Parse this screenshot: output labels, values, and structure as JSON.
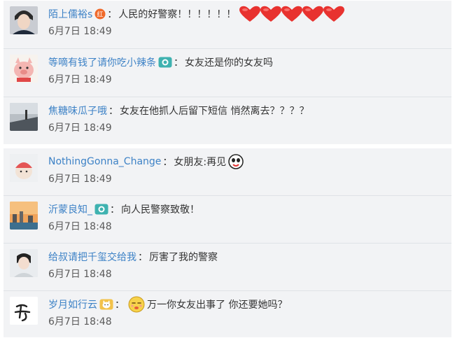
{
  "comments": [
    {
      "user": "陌上儒裕s",
      "badge": "vip-red-badge-icon",
      "text": "人民的好警察！！！！！！",
      "extra": "hearts",
      "time": "6月7日 18:49"
    },
    {
      "user": "等嘀有钱了请你吃小辣条",
      "badge": "camera-badge-icon",
      "text": "女友还是你的女友吗",
      "time": "6月7日 18:49"
    },
    {
      "user": "焦糖味瓜子哦",
      "badge": "",
      "text": "女友在他抓人后留下短信 悄然离去？？？？",
      "time": "6月7日 18:49"
    },
    {
      "user": "NothingGonna_Change",
      "badge": "",
      "text": "女朋友:再见",
      "extra": "wave-emoji",
      "time": "6月7日 18:49"
    },
    {
      "user": "沂蒙良知_",
      "badge": "camera-badge-icon",
      "text": "向人民警察致敬！",
      "time": "6月7日 18:48"
    },
    {
      "user": "给叔请把千玺交给我",
      "badge": "",
      "text": "厉害了我的警察",
      "time": "6月7日 18:48"
    },
    {
      "user": "岁月如行云",
      "badge": "cat-badge-icon",
      "pre_emoji": "face-emoji",
      "text": "万一你女友出事了 你还要她吗？",
      "time": "6月7日 18:48"
    }
  ],
  "colors": {
    "username": "#3d82c6",
    "text": "#333333",
    "time": "#5a5a5a",
    "panel": "#f2f3f5",
    "heart": "#e8322f"
  }
}
